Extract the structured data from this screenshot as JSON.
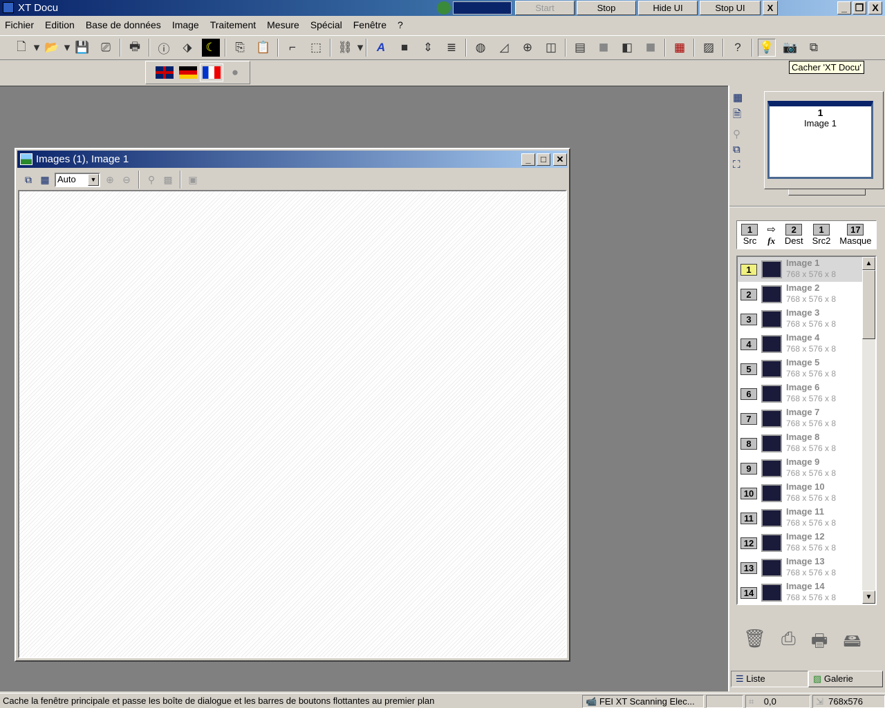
{
  "app": {
    "title": "XT Docu",
    "progress_color": "#0a246a"
  },
  "title_buttons": {
    "start": "Start",
    "stop": "Stop",
    "hide_ui": "Hide UI",
    "stop_ui": "Stop UI",
    "close": "X"
  },
  "window_controls": {
    "minimize": "_",
    "restore": "❐",
    "close": "X"
  },
  "menu": [
    "Fichier",
    "Edition",
    "Base de données",
    "Image",
    "Traitement",
    "Mesure",
    "Spécial",
    "Fenêtre",
    "?"
  ],
  "toolbar": {
    "icons": [
      "new-document-icon",
      "dropdown-arrow-icon",
      "open-folder-icon",
      "dropdown-arrow-icon",
      "save-icon",
      "scanner-icon",
      "|",
      "print-icon",
      "|",
      "info-icon",
      "tag-icon",
      "night-mode-icon",
      "|",
      "copy-icon",
      "paste-icon",
      "|",
      "crop-icon",
      "selection-icon",
      "|",
      "network-icon",
      "dropdown-arrow-icon",
      "|",
      "annotate-icon",
      "black-square-icon",
      "move-vertical-icon",
      "stack-icon",
      "|",
      "blend-icon",
      "chart-icon",
      "rgb-icon",
      "split-icon",
      "|",
      "calculator-icon",
      "gray-square-icon",
      "compare-icon",
      "gray-square-icon",
      "|",
      "grid-icon",
      "|",
      "landscape-icon",
      "|",
      "help-pointer-icon",
      "|",
      "lightbulb-icon",
      "camera-icon",
      "windows-icon"
    ],
    "tooltip": "Cacher 'XT Docu'"
  },
  "languages": [
    "english-flag-icon",
    "german-flag-icon",
    "french-flag-icon",
    "neutral-icon"
  ],
  "image_window": {
    "title": "Images (1), Image 1",
    "zoom_value": "Auto",
    "controls": {
      "minimize": "_",
      "maximize": "□",
      "close": "✕"
    }
  },
  "preview": {
    "number": "1",
    "name": "Image 1"
  },
  "slots": [
    {
      "num": "1",
      "label": "Src"
    },
    {
      "num": "",
      "label": "fx"
    },
    {
      "num": "2",
      "label": "Dest"
    },
    {
      "num": "1",
      "label": "Src2"
    },
    {
      "num": "17",
      "label": "Masque"
    }
  ],
  "images": [
    {
      "num": "1",
      "name": "Image 1",
      "size": "768 x 576 x 8",
      "selected": true
    },
    {
      "num": "2",
      "name": "Image 2",
      "size": "768 x 576 x 8"
    },
    {
      "num": "3",
      "name": "Image 3",
      "size": "768 x 576 x 8"
    },
    {
      "num": "4",
      "name": "Image 4",
      "size": "768 x 576 x 8"
    },
    {
      "num": "5",
      "name": "Image 5",
      "size": "768 x 576 x 8"
    },
    {
      "num": "6",
      "name": "Image 6",
      "size": "768 x 576 x 8"
    },
    {
      "num": "7",
      "name": "Image 7",
      "size": "768 x 576 x 8"
    },
    {
      "num": "8",
      "name": "Image 8",
      "size": "768 x 576 x 8"
    },
    {
      "num": "9",
      "name": "Image 9",
      "size": "768 x 576 x 8"
    },
    {
      "num": "10",
      "name": "Image 10",
      "size": "768 x 576 x 8"
    },
    {
      "num": "11",
      "name": "Image 11",
      "size": "768 x 576 x 8"
    },
    {
      "num": "12",
      "name": "Image 12",
      "size": "768 x 576 x 8"
    },
    {
      "num": "13",
      "name": "Image 13",
      "size": "768 x 576 x 8"
    },
    {
      "num": "14",
      "name": "Image 14",
      "size": "768 x 576 x 8"
    }
  ],
  "tabs": {
    "list": "Liste",
    "gallery": "Galerie"
  },
  "status": {
    "message": "Cache la fenêtre principale et passe les boîte de dialogue et les barres de boutons flottantes au premier plan",
    "device": "FEI XT Scanning Elec...",
    "position": "0,0",
    "dimensions": "768x576"
  }
}
